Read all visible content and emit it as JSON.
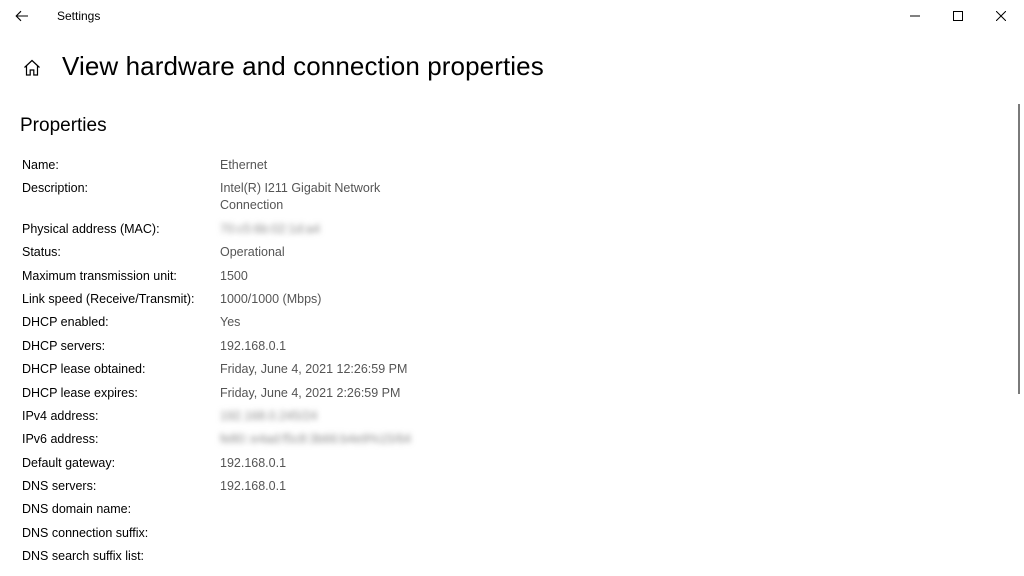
{
  "titlebar": {
    "app_title": "Settings"
  },
  "header": {
    "page_title": "View hardware and connection properties"
  },
  "section": {
    "title": "Properties"
  },
  "properties": [
    {
      "label": "Name:",
      "value": "Ethernet",
      "blurred": false
    },
    {
      "label": "Description:",
      "value": "Intel(R) I211 Gigabit Network Connection",
      "blurred": false
    },
    {
      "label": "Physical address (MAC):",
      "value": "70:c5:6b:02:1d:a4",
      "blurred": true
    },
    {
      "label": "Status:",
      "value": "Operational",
      "blurred": false
    },
    {
      "label": "Maximum transmission unit:",
      "value": "1500",
      "blurred": false
    },
    {
      "label": "Link speed (Receive/Transmit):",
      "value": "1000/1000 (Mbps)",
      "blurred": false
    },
    {
      "label": "DHCP enabled:",
      "value": "Yes",
      "blurred": false
    },
    {
      "label": "DHCP servers:",
      "value": "192.168.0.1",
      "blurred": false
    },
    {
      "label": "DHCP lease obtained:",
      "value": "Friday, June 4, 2021 12:26:59 PM",
      "blurred": false
    },
    {
      "label": "DHCP lease expires:",
      "value": "Friday, June 4, 2021 2:26:59 PM",
      "blurred": false
    },
    {
      "label": "IPv4 address:",
      "value": "192.168.0.245/24",
      "blurred": true
    },
    {
      "label": "IPv6 address:",
      "value": "fe80::e4ad:f5c8:3b66:b4e9%15/64",
      "blurred": true
    },
    {
      "label": "Default gateway:",
      "value": "192.168.0.1",
      "blurred": false
    },
    {
      "label": "DNS servers:",
      "value": "192.168.0.1",
      "blurred": false
    },
    {
      "label": "DNS domain name:",
      "value": "",
      "blurred": false
    },
    {
      "label": "DNS connection suffix:",
      "value": "",
      "blurred": false
    },
    {
      "label": "DNS search suffix list:",
      "value": "",
      "blurred": false
    }
  ],
  "icons": {
    "back": "back-arrow-icon",
    "home": "home-icon",
    "minimize": "minimize-icon",
    "maximize": "maximize-icon",
    "close": "close-icon"
  }
}
